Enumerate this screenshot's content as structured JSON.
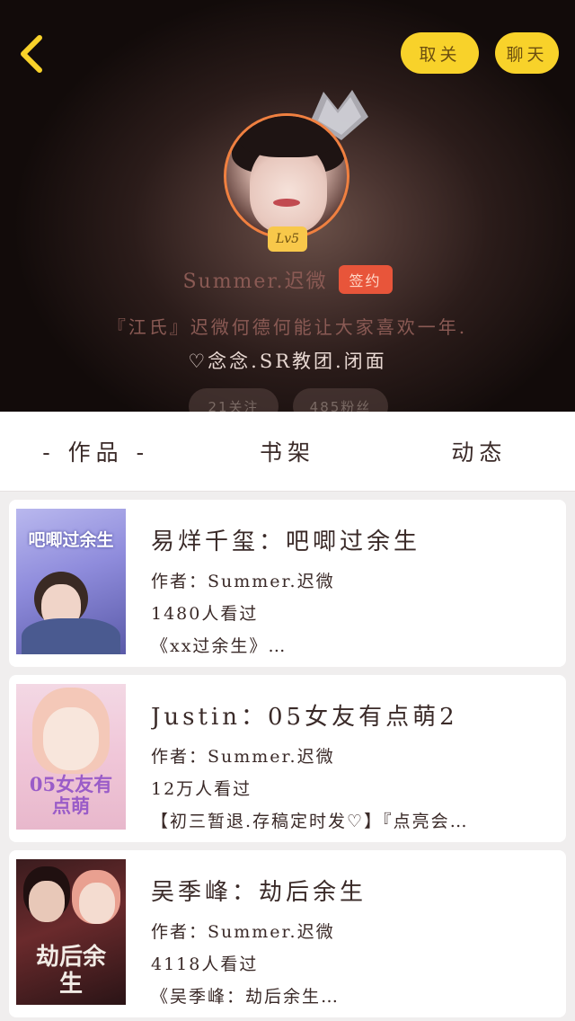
{
  "header": {
    "unfollow_label": "取关",
    "chat_label": "聊天",
    "level": "Lv5",
    "username": "Summer.迟微",
    "signed_label": "签约",
    "bio_line1": "『江氏』迟微何德何能让大家喜欢一年.",
    "bio_line2": "♡念念.SR教团.闭面",
    "following_label": "21关注",
    "followers_label": "485粉丝"
  },
  "tabs": [
    "- 作品 -",
    "书架",
    "动态"
  ],
  "works": [
    {
      "title": "易烊千玺：吧唧过余生",
      "author": "作者：Summer.迟微",
      "views": "1480人看过",
      "desc": "《xx过余生》…",
      "cover_text": "吧唧过余生"
    },
    {
      "title": "Justin：05女友有点萌2",
      "author": "作者：Summer.迟微",
      "views": "12万人看过",
      "desc": "【初三暂退.存稿定时发♡】『点亮会…",
      "cover_text": "05女友有点萌"
    },
    {
      "title": "吴季峰：劫后余生",
      "author": "作者：Summer.迟微",
      "views": "4118人看过",
      "desc": "《吴季峰：劫后余生…",
      "cover_text": "劫后余生"
    }
  ],
  "colors": {
    "accent_yellow": "#f8d22a",
    "signed_red": "#e8553a",
    "avatar_ring": "#f08040"
  }
}
